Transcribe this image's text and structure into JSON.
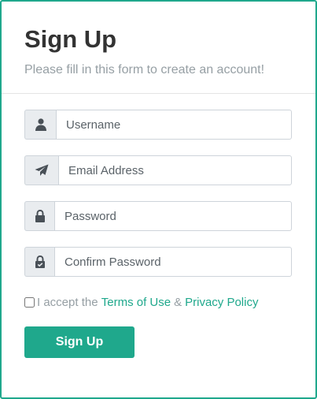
{
  "form": {
    "title": "Sign Up",
    "subtitle": "Please fill in this form to create an account!",
    "fields": [
      {
        "icon": "user-icon",
        "placeholder": "Username",
        "value": ""
      },
      {
        "icon": "paper-plane-icon",
        "placeholder": "Email Address",
        "value": ""
      },
      {
        "icon": "lock-icon",
        "placeholder": "Password",
        "value": ""
      },
      {
        "icon": "lock-check-icon",
        "placeholder": "Confirm Password",
        "value": ""
      }
    ],
    "terms": {
      "prefix": "I accept the",
      "terms_link": "Terms of Use",
      "separator": "&",
      "privacy_link": "Privacy Policy",
      "checked": false
    },
    "submit_label": "Sign Up"
  },
  "colors": {
    "accent": "#1fa88c",
    "text_dark": "#333333",
    "text_muted": "#969fa4",
    "addon_bg": "#e9ecef",
    "border": "#ced4da"
  }
}
